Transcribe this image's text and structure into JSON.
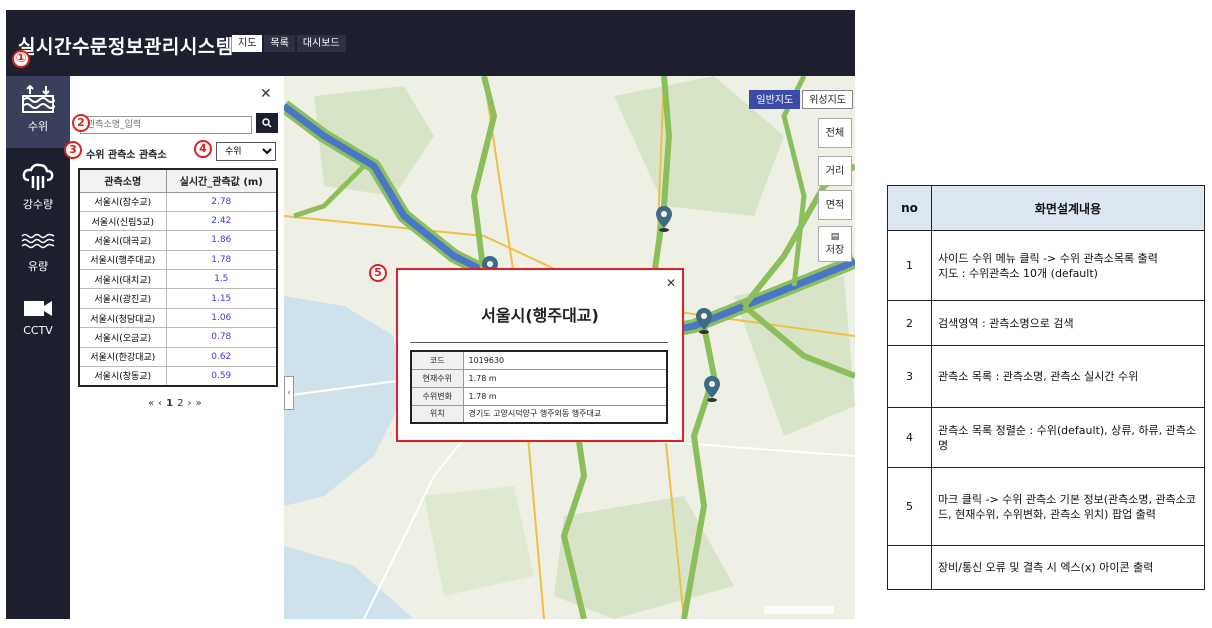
{
  "app": {
    "title": "실시간수문정보관리시스템",
    "tabs": [
      "지도",
      "목록",
      "대시보드"
    ],
    "active_tab": 0
  },
  "sidebar": {
    "items": [
      {
        "label": "수위",
        "icon": "water-level-icon",
        "active": true
      },
      {
        "label": "강수량",
        "icon": "rain-cloud-icon",
        "active": false
      },
      {
        "label": "유량",
        "icon": "flow-waves-icon",
        "active": false
      },
      {
        "label": "CCTV",
        "icon": "video-camera-icon",
        "active": false
      }
    ]
  },
  "panel": {
    "search_placeholder": "관측소명_입력",
    "heading": "수위 관측소 관측소",
    "sort_options": [
      "수위"
    ],
    "table": {
      "headers": [
        "관측소명",
        "실시간_관측값 (m)"
      ],
      "rows": [
        [
          "서울시(잠수교)",
          "2.78"
        ],
        [
          "서울시(신림5교)",
          "2.42"
        ],
        [
          "서울시(대곡교)",
          "1.86"
        ],
        [
          "서울시(행주대교)",
          "1.78"
        ],
        [
          "서울시(대치교)",
          "1.5"
        ],
        [
          "서울시(광진교)",
          "1.15"
        ],
        [
          "서울시(청담대교)",
          "1.06"
        ],
        [
          "서울시(오금교)",
          "0.78"
        ],
        [
          "서울시(한강대교)",
          "0.62"
        ],
        [
          "서울시(창동교)",
          "0.59"
        ]
      ]
    },
    "pager": {
      "prev_first": "«",
      "prev": "‹",
      "pages": [
        "1",
        "2"
      ],
      "next": "›",
      "next_last": "»"
    }
  },
  "map": {
    "type_buttons": [
      "일반지도",
      "위성지도"
    ],
    "active_type": 0,
    "tools": [
      "전체",
      "거리",
      "면적",
      "저장"
    ]
  },
  "popup": {
    "title": "서울시(행주대교)",
    "rows": [
      {
        "label": "코드",
        "value": "1019630"
      },
      {
        "label": "현재수위",
        "value": "1.78 m"
      },
      {
        "label": "수위변화",
        "value": "1.78 m"
      },
      {
        "label": "위치",
        "value": "경기도 고양시덕양구 행주외동 행주대교"
      }
    ]
  },
  "spec": {
    "headers": [
      "no",
      "화면설계내용"
    ],
    "rows": [
      {
        "no": "1",
        "text": "사이드 수위 메뉴 클릭 -> 수위 관측소목록 출력\n지도 : 수위관측소 10개 (default)"
      },
      {
        "no": "2",
        "text": "검색영역 : 관측소명으로 검색"
      },
      {
        "no": "3",
        "text": "관측소 목록 : 관측소명, 관측소 실시간 수위"
      },
      {
        "no": "4",
        "text": "관측소 목록 정렬순 : 수위(default), 상류, 하류, 관측소명"
      },
      {
        "no": "5",
        "text": "마크 클릭 -> 수위 관측소 기본 정보(관측소명, 관측소코드, 현재수위, 수위변화, 관측소 위치) 팝업 출력"
      },
      {
        "no": "",
        "text": "장비/통신 오류 및 결측 시 엑스(x) 아이콘 출력"
      }
    ]
  },
  "markers": [
    "①",
    "2",
    "3",
    "4",
    "5"
  ],
  "colors": {
    "accent_red": "#e02020",
    "nav_dark": "#1e1f2e",
    "value_blue": "#3b3bdc",
    "river_green": "#8bbf5c",
    "river_blue": "#4a76c8"
  }
}
